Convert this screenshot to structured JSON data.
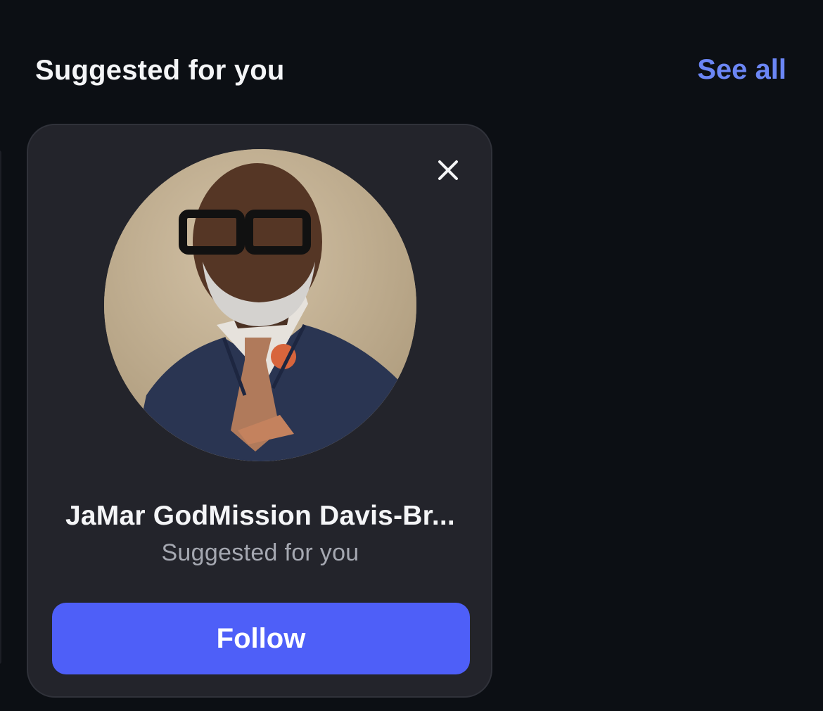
{
  "section": {
    "title": "Suggested for you",
    "see_all_label": "See all"
  },
  "card": {
    "name": "JaMar GodMission Davis-Br...",
    "subtitle": "Suggested for you",
    "follow_label": "Follow",
    "close_icon": "close-icon",
    "avatar_icon": "profile-photo"
  },
  "colors": {
    "background": "#0c0f14",
    "card": "#23242b",
    "accent": "#6b86f5",
    "follow_button": "#4e5ff8",
    "subtitle_text": "#a5a8b1"
  }
}
